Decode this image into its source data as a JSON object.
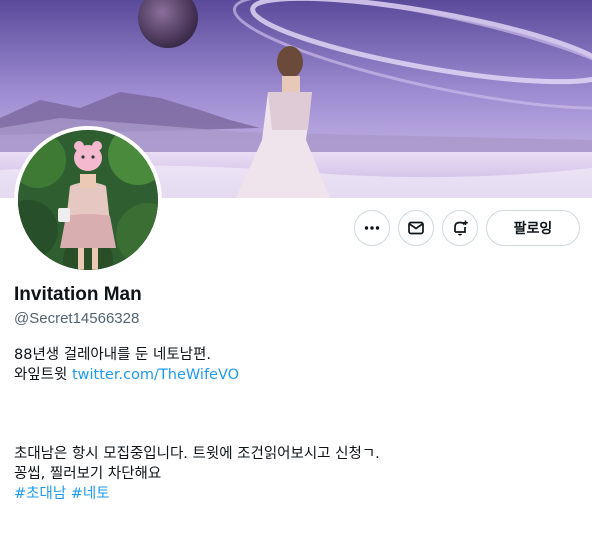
{
  "profile": {
    "name": "Invitation Man",
    "handle": "@Secret14566328",
    "follow_label": "팔로잉"
  },
  "bio": {
    "line1": "88년생 걸레아내를 둔 네토남편.",
    "line2_prefix": "와잎트윗 ",
    "line2_link": "twitter.com/TheWifeVO",
    "line3": "초대남은 항시 모집중입니다. 트윗에 조건읽어보시고 신청ㄱ.",
    "line4": "꽁씹, 찔러보기 차단해요",
    "hashtags": [
      "#초대남",
      "#네토"
    ]
  },
  "icons": {
    "more": "more-icon",
    "message": "mail-icon",
    "notify": "bell-plus-icon"
  },
  "colors": {
    "link": "#1d9bf0",
    "secondary_text": "#536471",
    "border": "#cfd9de"
  }
}
